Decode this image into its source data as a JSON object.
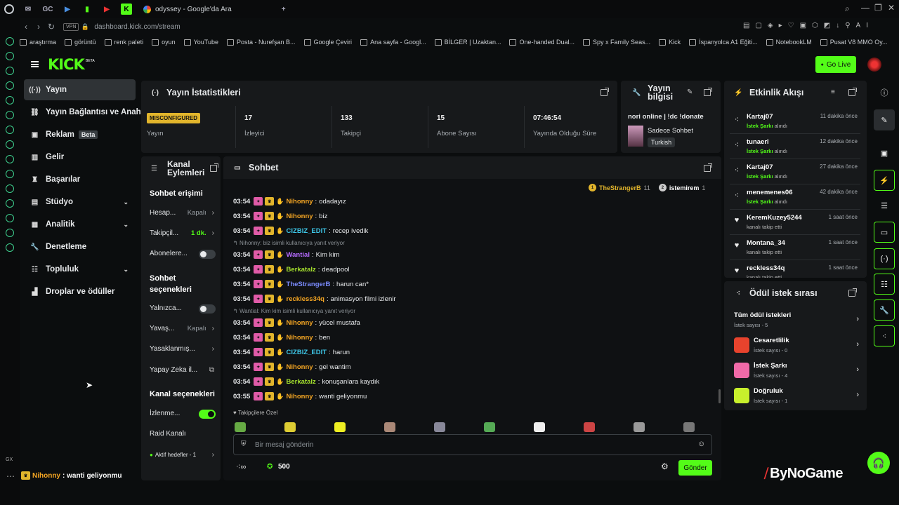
{
  "browser": {
    "tab_title": "odyssey - Google'da Ara",
    "url": "dashboard.kick.com/stream",
    "vpn": "VPN",
    "bookmarks": [
      "araştırma",
      "görüntü",
      "renk paleti",
      "oyun",
      "YouTube",
      "Posta - Nurefşan B...",
      "Google Çeviri",
      "Ana sayfa - Googl...",
      "BİLGER | Uzaktan...",
      "One-handed Dual...",
      "Spy x Family Seas...",
      "Kick",
      "İspanyolca A1 Eğiti...",
      "NotebookLM",
      "Pusat V8 MMO Oy..."
    ],
    "gx_label": "GX"
  },
  "header": {
    "go_live": "Go Live",
    "logo": "KICK",
    "logo_beta": "BETA"
  },
  "nav": {
    "items": [
      {
        "label": "Yayın"
      },
      {
        "label": "Yayın Bağlantısı ve Anahtarı"
      },
      {
        "label": "Reklam",
        "badge": "Beta"
      },
      {
        "label": "Gelir"
      },
      {
        "label": "Başarılar"
      },
      {
        "label": "Stüdyo"
      },
      {
        "label": "Analitik"
      },
      {
        "label": "Denetleme"
      },
      {
        "label": "Topluluk"
      },
      {
        "label": "Droplar ve ödüller"
      }
    ]
  },
  "stats": {
    "title": "Yayın İstatistikleri",
    "status": "MISCONFIGURED",
    "status_label": "Yayın",
    "viewers": "17",
    "viewers_label": "İzleyici",
    "followers": "133",
    "followers_label": "Takipçi",
    "subs": "15",
    "subs_label": "Abone Sayısı",
    "uptime": "07:46:54",
    "uptime_label": "Yayında Olduğu Süre"
  },
  "info": {
    "title": "Yayın bilgisi",
    "stream_title": "nori online | !dc !donate",
    "category": "Sadece Sohbet",
    "language": "Turkish"
  },
  "activity": {
    "title": "Etkinlik Akışı",
    "items": [
      {
        "name": "Kartaj07",
        "action": "İstek Şarkı",
        "suffix": " alındı",
        "time": "11 dakika önce"
      },
      {
        "name": "tunaerl",
        "action": "İstek Şarkı",
        "suffix": " alındı",
        "time": "12 dakika önce"
      },
      {
        "name": "Kartaj07",
        "action": "İstek Şarkı",
        "suffix": " alındı",
        "time": "27 dakika önce"
      },
      {
        "name": "menemenes06",
        "action": "İstek Şarkı",
        "suffix": " alındı",
        "time": "42 dakika önce"
      },
      {
        "name": "KeremKuzey5244",
        "action": "",
        "suffix": "kanalı takip etti",
        "time": "1 saat önce"
      },
      {
        "name": "Montana_34",
        "action": "",
        "suffix": "kanalı takip etti",
        "time": "1 saat önce"
      },
      {
        "name": "reckless34q",
        "action": "",
        "suffix": "kanalı takip etti",
        "time": "1 saat önce"
      }
    ]
  },
  "channel_actions": {
    "title": "Kanal Eylemleri",
    "chat_access": "Sohbet erişimi",
    "account": "Hesap...",
    "account_val": "Kapalı",
    "followers": "Takipçil...",
    "followers_val": "1 dk.",
    "subscribers": "Abonelere...",
    "chat_options": "Sohbet seçenekleri",
    "only": "Yalnızca...",
    "slow": "Yavaş...",
    "slow_val": "Kapalı",
    "banned": "Yasaklanmış...",
    "ai": "Yapay Zeka il...",
    "channel_options": "Kanal seçenekleri",
    "watch": "İzlenme...",
    "raid": "Raid Kanalı",
    "goals": "Aktif hedefler - 1"
  },
  "chat": {
    "title": "Sohbet",
    "top_gifters": [
      {
        "rank": "1",
        "name": "TheStrangerB",
        "count": "11"
      },
      {
        "rank": "2",
        "name": "istemirem",
        "count": "1"
      }
    ],
    "messages": [
      {
        "time": "03:54",
        "user": "Nihonny",
        "color": "#f5a623",
        "text": "odadayız"
      },
      {
        "time": "03:54",
        "user": "Nihonny",
        "color": "#f5a623",
        "text": "biz"
      },
      {
        "time": "03:54",
        "user": "CIZBIZ_EDIT",
        "color": "#3ec7e8",
        "text": "recep ivedik"
      },
      {
        "reply": "Nihonny: biz isimli kullanıcıya yanıt veriyor"
      },
      {
        "time": "03:54",
        "user": "Wantial",
        "color": "#b66cff",
        "text": "Kim kim"
      },
      {
        "time": "03:54",
        "user": "Berkatalz",
        "color": "#a6e22e",
        "text": "deadpool"
      },
      {
        "time": "03:54",
        "user": "TheStrangerB",
        "color": "#7b8cff",
        "text": "harun can*"
      },
      {
        "time": "03:54",
        "user": "reckless34q",
        "color": "#f5a623",
        "text": "animasyon filmi izlenir"
      },
      {
        "reply": "Wantial: Kim kim isimli kullanıcıya yanıt veriyor"
      },
      {
        "time": "03:54",
        "user": "Nihonny",
        "color": "#f5a623",
        "text": "yücel mustafa"
      },
      {
        "time": "03:54",
        "user": "Nihonny",
        "color": "#f5a623",
        "text": "ben"
      },
      {
        "time": "03:54",
        "user": "CIZBIZ_EDIT",
        "color": "#3ec7e8",
        "text": "harun"
      },
      {
        "time": "03:54",
        "user": "Nihonny",
        "color": "#f5a623",
        "text": "gel wantim"
      },
      {
        "time": "03:54",
        "user": "Berkatalz",
        "color": "#a6e22e",
        "text": "konuşanlara kaydık"
      },
      {
        "time": "03:55",
        "user": "Nihonny",
        "color": "#f5a623",
        "text": "wanti geliyonmu"
      }
    ],
    "followers_only": "Takipçilere Özel",
    "placeholder": "Bir mesaj gönderin",
    "points": "500",
    "send": "Gönder"
  },
  "rewards": {
    "title": "Ödül istek sırası",
    "all": "Tüm ödül istekleri",
    "all_count": "İstek sayısı - 5",
    "items": [
      {
        "name": "Cesaretlilik",
        "count": "İstek sayısı - 0",
        "color": "#e8432d"
      },
      {
        "name": "İstek Şarkı",
        "count": "İstek sayısı - 4",
        "color": "#f06aa8"
      },
      {
        "name": "Doğruluk",
        "count": "İstek sayısı - 1",
        "color": "#c8f02c"
      }
    ]
  },
  "bottom_chat": {
    "user": "Nihonny",
    "text": " : wanti geliyonmu"
  },
  "watermark": "ByNoGame"
}
